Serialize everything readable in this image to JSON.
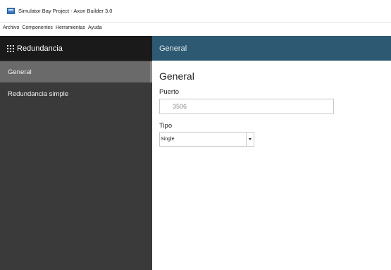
{
  "window": {
    "title": "Simulator Bay Project - Axon Builder 3.0",
    "icon": "app-window-icon"
  },
  "menu": [
    "Archivo",
    "Componentes",
    "Herramientas",
    "Ayuda"
  ],
  "sidebar": {
    "header": "Redundancia",
    "header_icon": "grid-icon",
    "items": [
      {
        "label": "General",
        "selected": true
      },
      {
        "label": "Redundancia simple",
        "selected": false
      }
    ]
  },
  "content": {
    "header": "General",
    "section_title": "General",
    "puerto": {
      "label": "Puerto",
      "value": "3506"
    },
    "tipo": {
      "label": "Tipo",
      "value": "Single"
    }
  },
  "colors": {
    "sidebar_bg": "#3a3a3a",
    "sidebar_header_bg": "#1a1a1a",
    "sidebar_selected_bg": "#6a6a6a",
    "content_header_bg": "#2d5a72"
  }
}
